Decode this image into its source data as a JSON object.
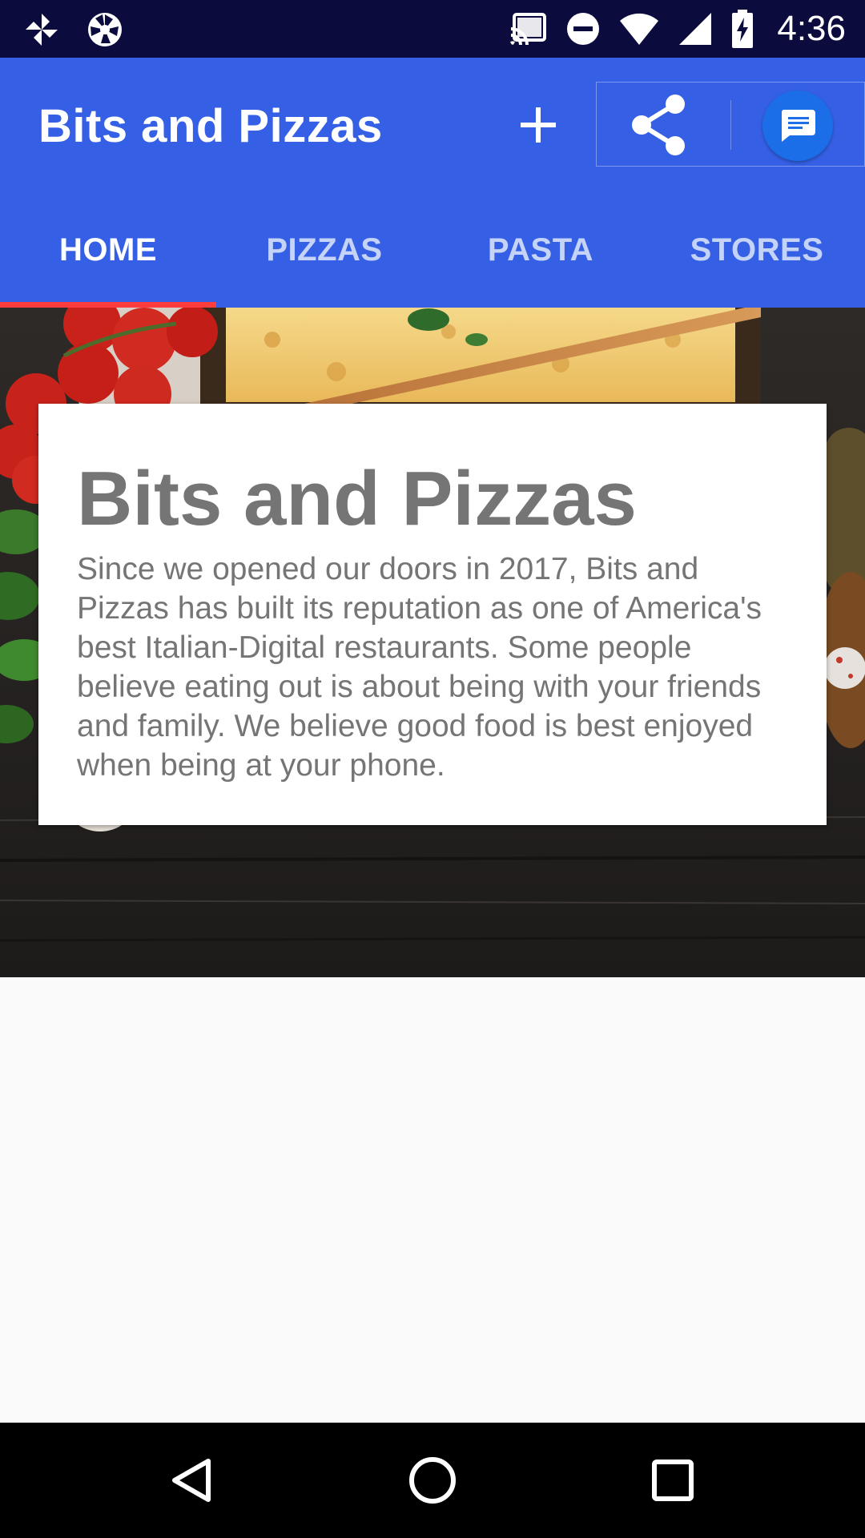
{
  "status_bar": {
    "time": "4:36",
    "left_icons": [
      "pinwheel-icon",
      "aperture-icon"
    ],
    "right_icons": [
      "cast-icon",
      "do-not-disturb-icon",
      "wifi-icon",
      "signal-icon",
      "battery-charging-icon"
    ]
  },
  "app_bar": {
    "title": "Bits and Pizzas",
    "actions": [
      "plus-icon",
      "share-icon",
      "chat-icon"
    ],
    "color": "#3560e6"
  },
  "tabs": [
    {
      "label": "HOME",
      "active": true
    },
    {
      "label": "PIZZAS",
      "active": false
    },
    {
      "label": "PASTA",
      "active": false
    },
    {
      "label": "STORES",
      "active": false
    }
  ],
  "tab_indicator_color": "#ff3d3d",
  "card": {
    "title": "Bits and Pizzas",
    "body": "Since we opened our doors in 2017, Bits and Pizzas has built its reputation as one of America's best Italian-Digital restaurants. Some people believe eating out is about being with your friends and family. We believe good food is best enjoyed when being at your phone."
  },
  "nav_bar": {
    "buttons": [
      "back-icon",
      "home-icon",
      "recents-icon"
    ]
  }
}
